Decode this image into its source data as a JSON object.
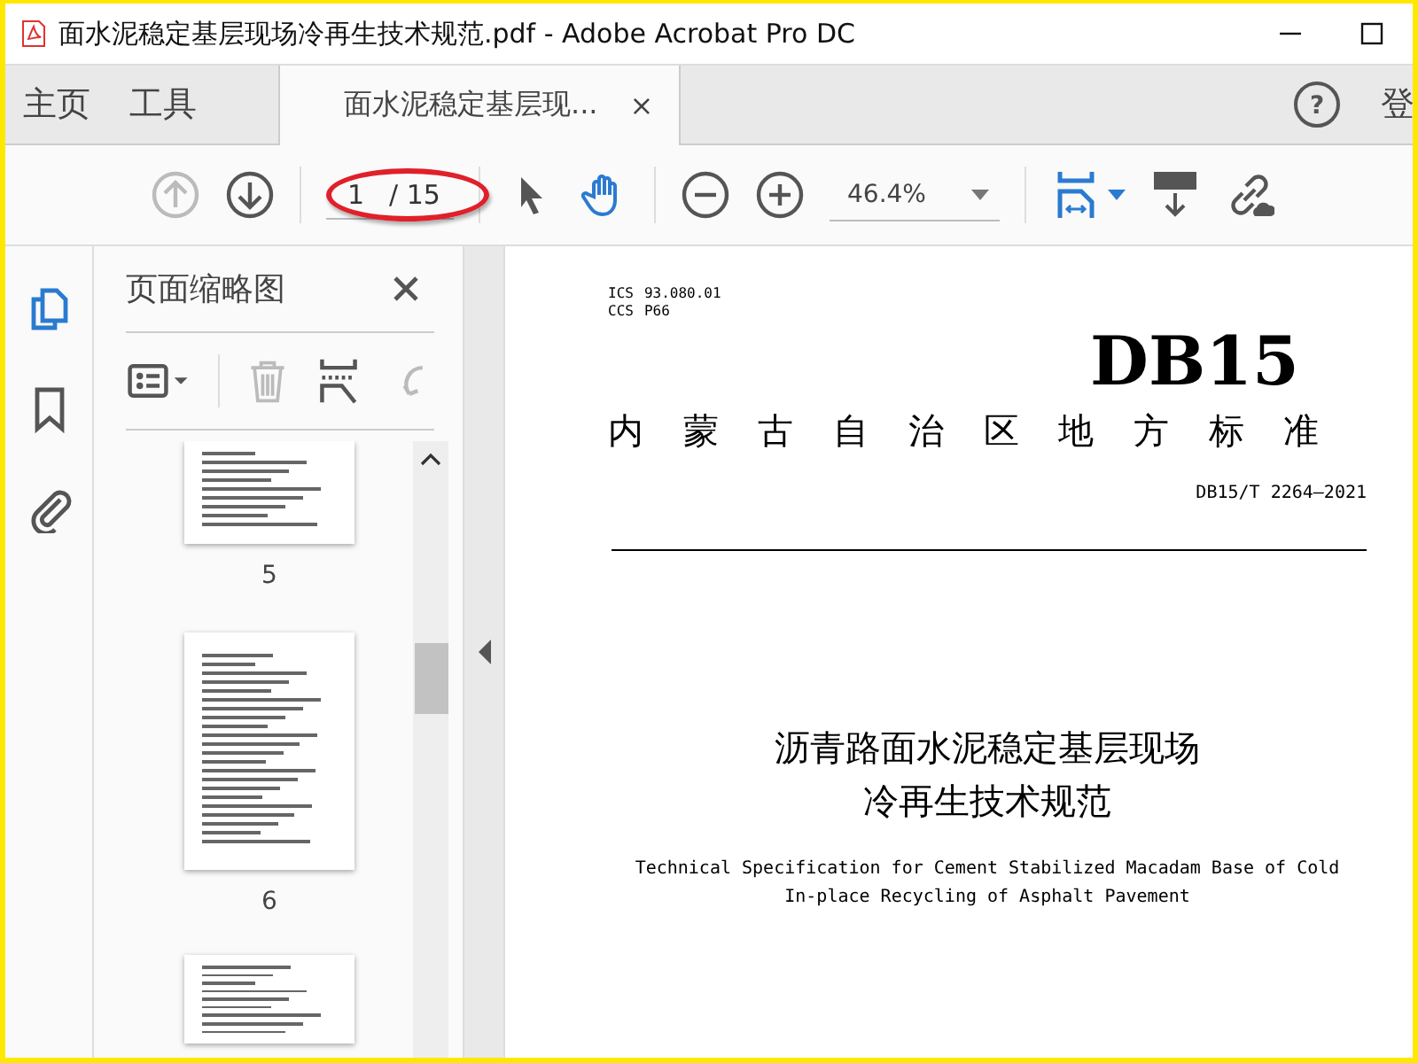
{
  "window": {
    "title": "面水泥稳定基层现场冷再生技术规范.pdf - Adobe Acrobat Pro DC"
  },
  "nav_tabs": [
    {
      "label": "主页",
      "selected": false
    },
    {
      "label": "工具",
      "selected": false
    },
    {
      "label": "面水泥稳定基层现...",
      "selected": true,
      "close": "×"
    }
  ],
  "help": {
    "label": "?"
  },
  "account": {
    "label": "登"
  },
  "toolbar": [
    {
      "kind": "prev-page",
      "disabled": true
    },
    {
      "kind": "next-page",
      "disabled": false
    },
    {
      "kind": "page-field",
      "value": "1",
      "total": "/ 15"
    },
    {
      "kind": "select-tool",
      "disabled": false
    },
    {
      "kind": "hand-tool",
      "disabled": false,
      "selected": true
    },
    {
      "kind": "zoom-out",
      "disabled": false
    },
    {
      "kind": "zoom-in",
      "disabled": false
    },
    {
      "kind": "zoom-field",
      "value": "46.4%"
    },
    {
      "kind": "fit-page",
      "disabled": false
    },
    {
      "kind": "scroll-mode",
      "disabled": false
    },
    {
      "kind": "share-link",
      "disabled": false
    }
  ],
  "side_rail": [
    {
      "kind": "pages",
      "selected": true
    },
    {
      "kind": "bookmarks",
      "selected": false
    },
    {
      "kind": "attachments",
      "selected": false
    }
  ],
  "panel": {
    "title": "页面缩略图",
    "tools": [
      {
        "kind": "options",
        "disabled": false
      },
      {
        "kind": "delete",
        "disabled": true
      },
      {
        "kind": "insert",
        "disabled": false
      },
      {
        "kind": "rotate",
        "disabled": true
      }
    ],
    "thumbnails": [
      {
        "label": "5",
        "selected": false,
        "kind": "partial-top"
      },
      {
        "label": "6",
        "selected": false,
        "kind": "full"
      },
      {
        "kind": "partial-bottom",
        "selected": false
      }
    ]
  },
  "document": {
    "ics_label": "ICS",
    "ics": "93.080.01",
    "ccs_label": "CCS",
    "ccs": "P66",
    "logo": "DB15",
    "authority": "内 蒙 古 自 治 区 地 方 标 准",
    "code": "DB15/T 2264—2021",
    "title_lines": [
      "沥青路面水泥稳定基层现场",
      "冷再生技术规范"
    ],
    "english_lines": [
      "Technical Specification for Cement Stabilized Macadam Base of Cold",
      "In-place Recycling of Asphalt Pavement"
    ]
  }
}
